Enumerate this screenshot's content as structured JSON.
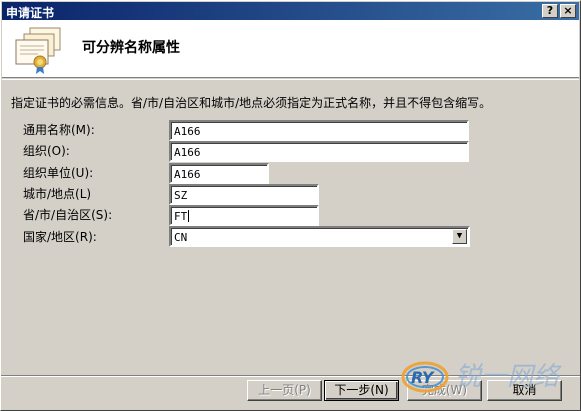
{
  "window": {
    "title": "申请证书",
    "help_button": "?",
    "close_button": "×"
  },
  "header": {
    "heading": "可分辨名称属性"
  },
  "description": "指定证书的必需信息。省/市/自治区和城市/地点必须指定为正式名称，并且不得包含缩写。",
  "form": {
    "common_name": {
      "label": "通用名称(M):",
      "value": "A166"
    },
    "organization": {
      "label": "组织(O):",
      "value": "A166"
    },
    "org_unit": {
      "label": "组织单位(U):",
      "value": "A166"
    },
    "city": {
      "label": "城市/地点(L)",
      "value": "SZ"
    },
    "state": {
      "label": "省/市/自治区(S):",
      "value": "FT"
    },
    "country": {
      "label": "国家/地区(R):",
      "value": "CN"
    }
  },
  "buttons": {
    "back": "上一页(P)",
    "next": "下一步(N)",
    "finish": "完成(W)",
    "cancel": "取消"
  },
  "watermark": {
    "logo_text": "RY",
    "brand_text": "锐一网络"
  },
  "icons": {
    "header_icon": "certificate-icon",
    "dropdown": "chevron-down-icon"
  }
}
